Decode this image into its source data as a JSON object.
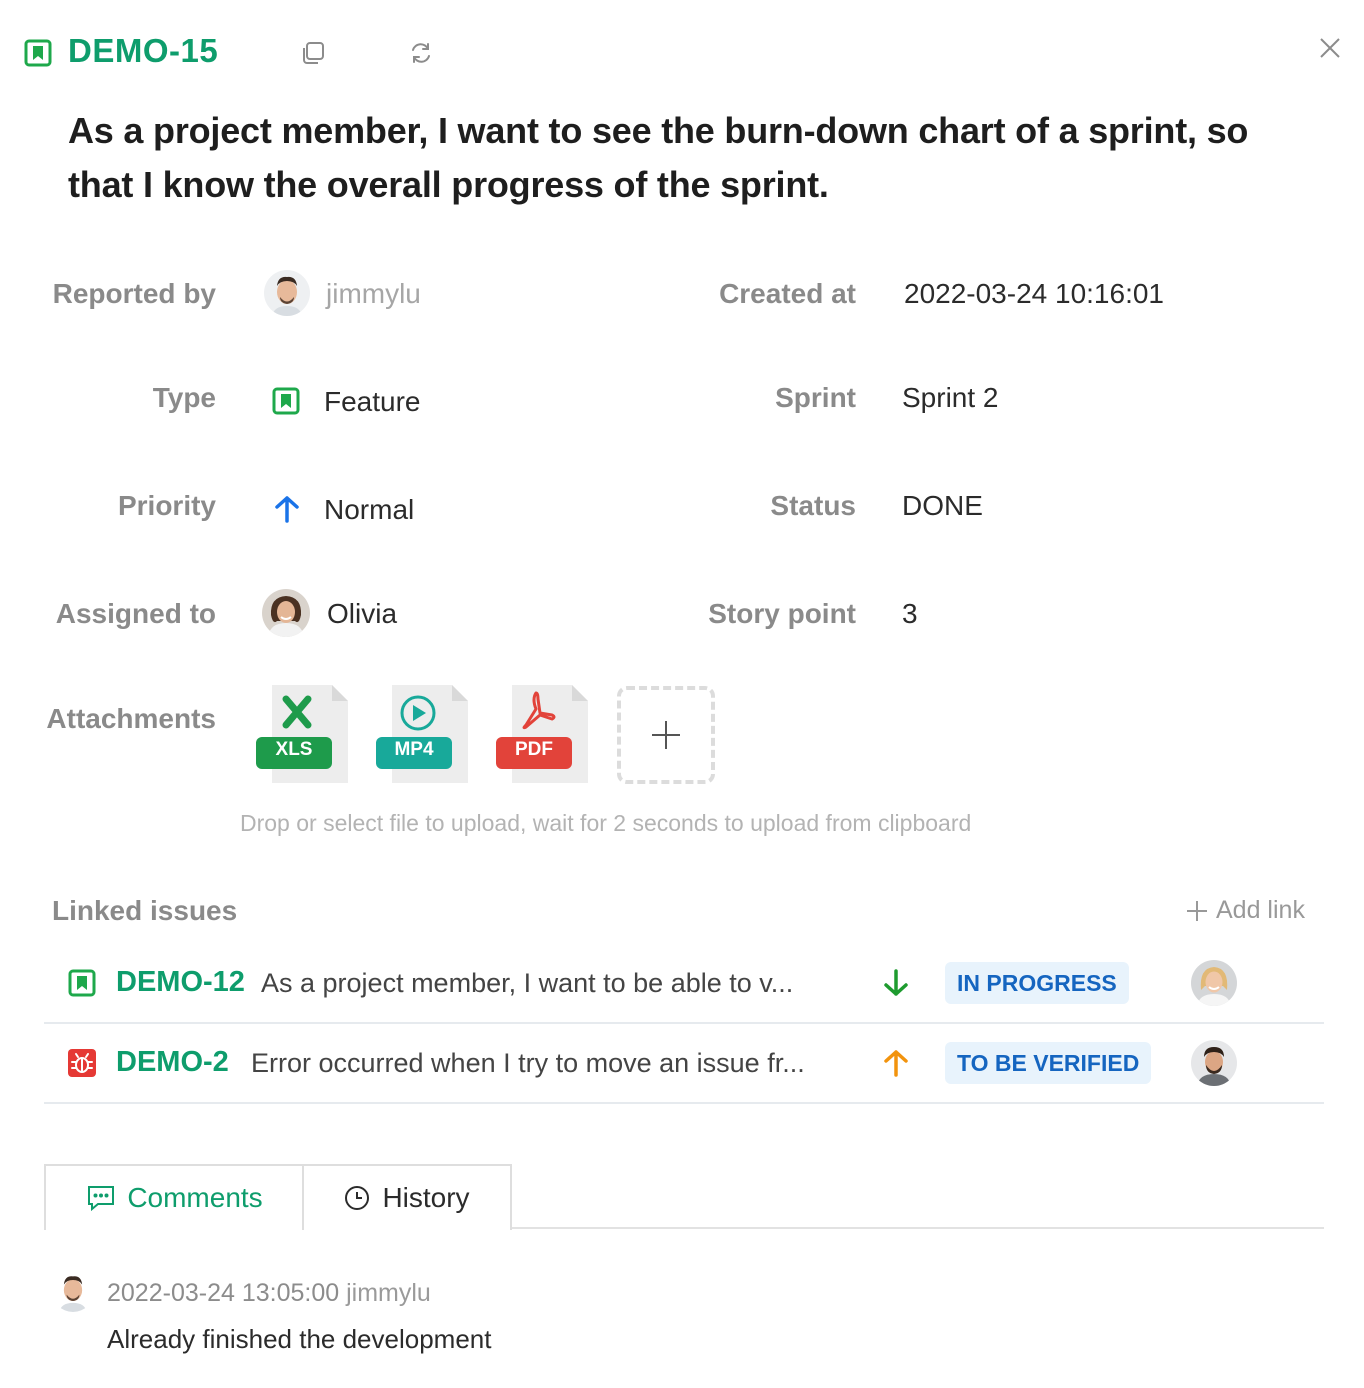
{
  "issue": {
    "key": "DEMO-15",
    "title": "As a project member, I want to see the burn-down chart of a sprint, so that I know the overall progress of the sprint."
  },
  "fields": {
    "reported_by": {
      "label": "Reported by",
      "value": "jimmylu"
    },
    "created_at": {
      "label": "Created at",
      "value": "2022-03-24 10:16:01"
    },
    "type": {
      "label": "Type",
      "value": "Feature"
    },
    "sprint": {
      "label": "Sprint",
      "value": "Sprint 2"
    },
    "priority": {
      "label": "Priority",
      "value": "Normal"
    },
    "status": {
      "label": "Status",
      "value": "DONE"
    },
    "assigned_to": {
      "label": "Assigned to",
      "value": "Olivia"
    },
    "story_point": {
      "label": "Story point",
      "value": "3"
    },
    "attachments": {
      "label": "Attachments",
      "files": [
        "XLS",
        "MP4",
        "PDF"
      ],
      "upload_hint": "Drop or select file to upload, wait for 2 seconds to upload from clipboard"
    }
  },
  "linked_issues": {
    "title": "Linked issues",
    "add_label": "Add link",
    "items": [
      {
        "key": "DEMO-12",
        "title": "As a project member, I want to be able to v...",
        "type": "feature",
        "priority": "down",
        "status": "IN PROGRESS"
      },
      {
        "key": "DEMO-2",
        "title": "Error occurred when I try to move an issue fr...",
        "type": "bug",
        "priority": "up",
        "status": "TO BE VERIFIED"
      }
    ]
  },
  "tabs": {
    "comments": "Comments",
    "history": "History"
  },
  "comments": [
    {
      "timestamp": "2022-03-24 13:05:00",
      "author": "jimmylu",
      "text": "Already finished the development"
    }
  ],
  "colors": {
    "accent": "#0e9d6c",
    "priority_normal": "#1a73e8",
    "priority_down": "#1e9b2f",
    "priority_up": "#f2930d",
    "bug": "#e53935",
    "xls": "#1e9b4b",
    "mp4": "#18a99a",
    "pdf": "#e2433a"
  }
}
